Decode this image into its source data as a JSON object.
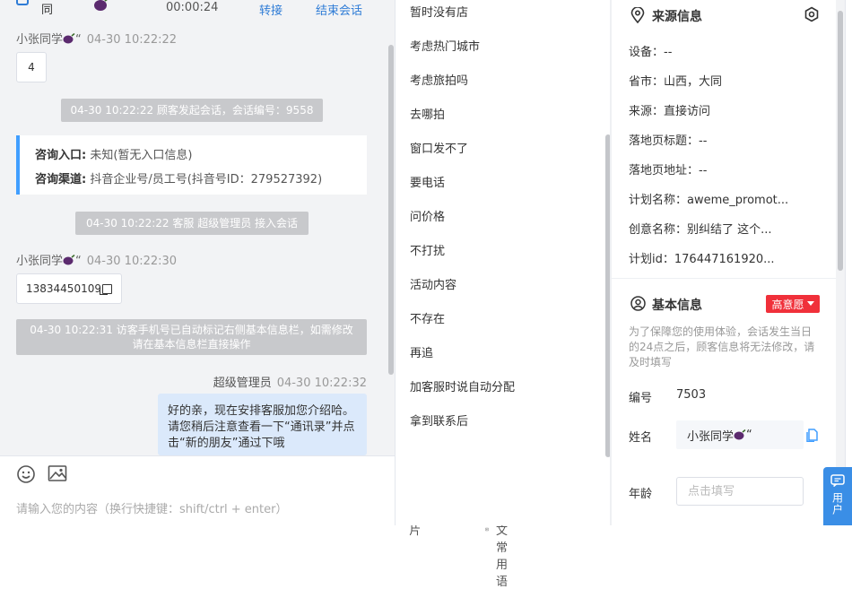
{
  "header": {
    "visitor_name": "同",
    "duration": "00:00:24",
    "transfer_label": "转接",
    "end_label": "结束会话"
  },
  "messages": {
    "m1_sender": "小张同学",
    "m1_suffix": "“",
    "m1_time": "04-30 10:22:22",
    "m1_text": "4",
    "sys1": "04-30 10:22:22 顾客发起会话，会话编号：9558",
    "card_entry_label": "咨询入口:",
    "card_entry_value": "未知(暂无入口信息)",
    "card_channel_label": "咨询渠道:",
    "card_channel_value": "抖音企业号/员工号(抖音号ID：279527392)",
    "sys2": "04-30 10:22:22 客服 超级管理员 接入会话",
    "m2_sender": "小张同学",
    "m2_suffix": "“",
    "m2_time": "04-30 10:22:30",
    "m2_text": "13834450109",
    "sys3": "04-30 10:22:31 访客手机号已自动标记右侧基本信息栏，如需修改请在基本信息栏直接操作",
    "m3_sender": "超级管理员",
    "m3_time": "04-30 10:22:32",
    "m3_text": "好的亲，现在安排客服加您介绍哈。请您稍后注意查看一下“通讯录”并点击“新的朋友”通过下哦"
  },
  "composer": {
    "emoji_icon": "smile-icon",
    "image_icon": "image-icon",
    "card_label": "留资卡片",
    "collect_label": "收起图文常用语",
    "placeholder": "请输入您的内容（换行快捷键：shift/ctrl + enter）"
  },
  "phrases": [
    "暂时没有店",
    "考虑热门城市",
    "考虑旅拍吗",
    "去哪拍",
    "窗口发不了",
    "要电话",
    "问价格",
    "不打扰",
    "活动内容",
    "不存在",
    "再追",
    "加客服时说自动分配",
    "拿到联系后"
  ],
  "source": {
    "title": "来源信息",
    "device_label": "设备：",
    "device_value": "--",
    "province_label": "省市：",
    "province_value": "山西，大同",
    "from_label": "来源：",
    "from_value": "直接访问",
    "landing_title_label": "落地页标题：",
    "landing_title_value": "--",
    "landing_url_label": "落地页地址：",
    "landing_url_value": "--",
    "plan_name_label": "计划名称：",
    "plan_name_value": "aweme_promot...",
    "creative_label": "创意名称：",
    "creative_value": "别纠结了 这个...",
    "plan_id_label": "计划id：",
    "plan_id_value": "176447161920..."
  },
  "basic": {
    "title": "基本信息",
    "intent_badge": "高意愿",
    "note": "为了保障您的使用体验，会话发生当日的24点之后，顾客信息将无法修改，请及时填写",
    "number_label": "编号",
    "number_value": "7503",
    "name_label": "姓名",
    "name_value": "小张同学",
    "name_suffix": "“",
    "age_label": "年龄",
    "age_placeholder": "点击填写"
  },
  "float_button": {
    "label": "用户"
  },
  "colors": {
    "accent": "#409eff",
    "link": "#2f7cd6",
    "badge": "#f0303a",
    "out_bubble": "#dbe9fb"
  }
}
